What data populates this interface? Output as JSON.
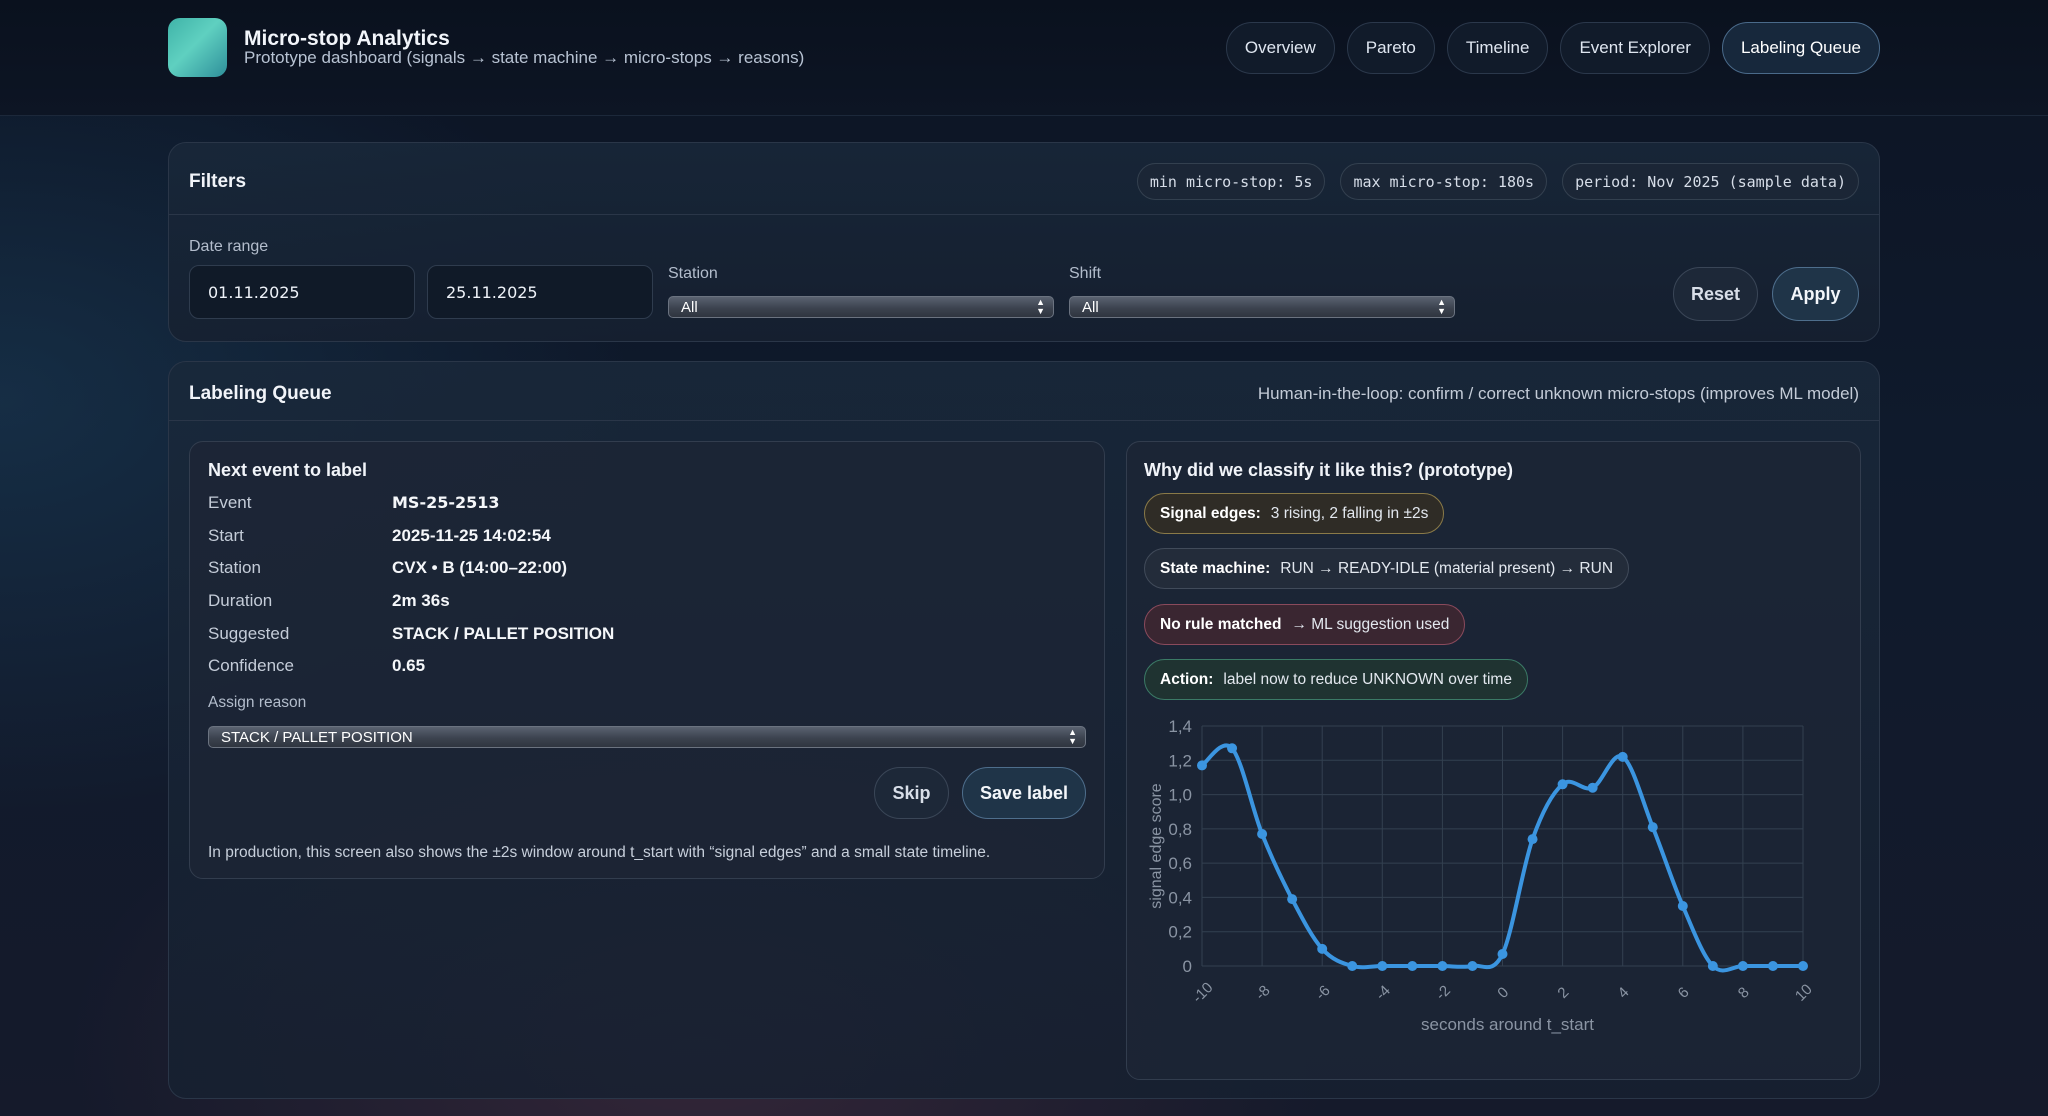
{
  "header": {
    "title": "Micro-stop Analytics",
    "subtitle": "Prototype dashboard (signals → state machine → micro-stops → reasons)",
    "nav": [
      "Overview",
      "Pareto",
      "Timeline",
      "Event Explorer",
      "Labeling Queue"
    ],
    "active_nav": "Labeling Queue"
  },
  "filters": {
    "title": "Filters",
    "chips": [
      "min micro-stop: 5s",
      "max micro-stop: 180s",
      "period: Nov 2025 (sample data)"
    ],
    "date_range_label": "Date range",
    "date_from": "01.11.2025",
    "date_to": "25.11.2025",
    "station_label": "Station",
    "station_value": "All",
    "shift_label": "Shift",
    "shift_value": "All",
    "reset_label": "Reset",
    "apply_label": "Apply"
  },
  "queue": {
    "title": "Labeling Queue",
    "description": "Human-in-the-loop: confirm / correct unknown micro-stops (improves ML model)",
    "next_event": {
      "title": "Next event to label",
      "fields": [
        {
          "key": "Event",
          "value": "MS-25-2513"
        },
        {
          "key": "Start",
          "value": "2025-11-25 14:02:54"
        },
        {
          "key": "Station",
          "value": "CVX • B (14:00–22:00)"
        },
        {
          "key": "Duration",
          "value": "2m 36s"
        },
        {
          "key": "Suggested",
          "value": "STACK / PALLET POSITION"
        },
        {
          "key": "Confidence",
          "value": "0.65"
        }
      ],
      "assign_label": "Assign reason",
      "assign_value": "STACK / PALLET POSITION",
      "skip_label": "Skip",
      "save_label": "Save label",
      "note": "In production, this screen also shows the ±2s window around t_start with “signal edges” and a small state timeline."
    },
    "why": {
      "title": "Why did we classify it like this? (prototype)",
      "pills": [
        {
          "bold": "Signal edges:",
          "text": "3 rising, 2 falling in ±2s"
        },
        {
          "bold": "State machine:",
          "text": "RUN → READY-IDLE (material present) → RUN"
        },
        {
          "bold": "No rule matched",
          "text": "→ ML suggestion used"
        },
        {
          "bold": "Action:",
          "text": "label now to reduce UNKNOWN over time"
        }
      ]
    }
  },
  "chart_data": {
    "type": "line",
    "x": [
      -10,
      -9,
      -8,
      -7,
      -6,
      -5,
      -4,
      -3,
      -2,
      -1,
      0,
      1,
      2,
      3,
      4,
      5,
      6,
      7,
      8,
      9,
      10
    ],
    "series": [
      {
        "values": [
          1.17,
          1.27,
          0.77,
          0.39,
          0.1,
          0,
          0,
          0,
          0,
          0,
          0.07,
          0.74,
          1.06,
          1.04,
          1.22,
          0.81,
          0.35,
          0,
          0,
          0,
          0
        ]
      }
    ],
    "xlabel": "seconds around t_start",
    "ylabel": "signal edge score",
    "xticks": [
      "-10",
      "-8",
      "-6",
      "-4",
      "-2",
      "0",
      "2",
      "4",
      "6",
      "8",
      "10"
    ],
    "yticks": [
      "0",
      "0,2",
      "0,4",
      "0,6",
      "0,8",
      "1,0",
      "1,2",
      "1,4"
    ],
    "ylim": [
      0,
      1.4
    ],
    "xlim": [
      -10,
      10
    ],
    "grid": true,
    "color": "#3b95e0"
  }
}
